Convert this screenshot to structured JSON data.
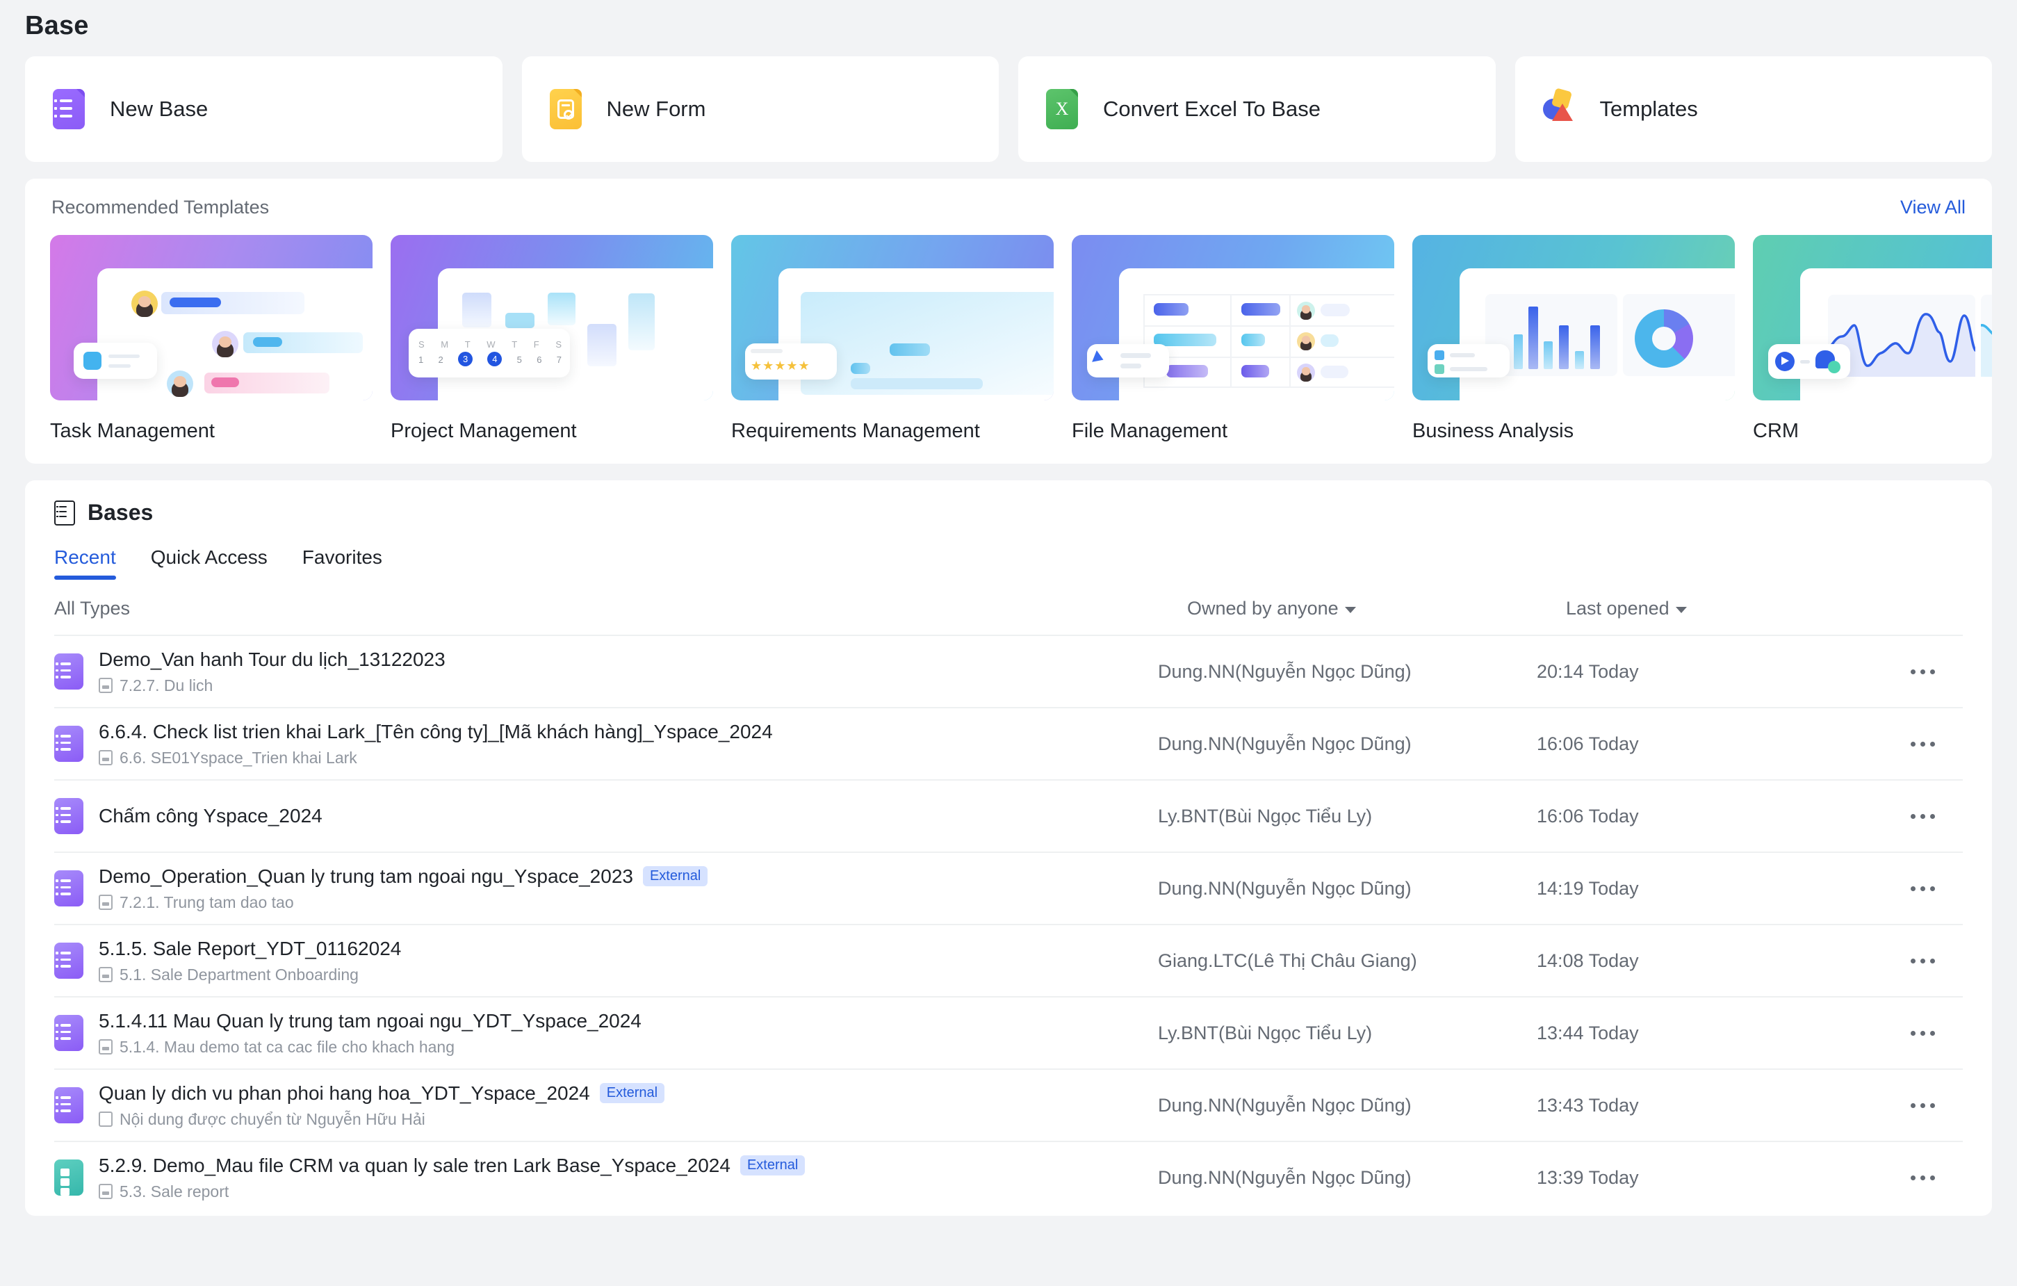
{
  "page": {
    "title": "Base"
  },
  "quick_actions": [
    {
      "label": "New Base",
      "icon": "base-icon"
    },
    {
      "label": "New Form",
      "icon": "form-icon"
    },
    {
      "label": "Convert Excel To Base",
      "icon": "excel-icon"
    },
    {
      "label": "Templates",
      "icon": "templates-icon"
    }
  ],
  "recommended": {
    "title": "Recommended Templates",
    "view_all_label": "View All",
    "templates": [
      {
        "name": "Task Management"
      },
      {
        "name": "Project Management",
        "calendar": {
          "weekdays": [
            "S",
            "M",
            "T",
            "W",
            "T",
            "F",
            "S"
          ],
          "days": [
            "1",
            "2",
            "3",
            "4",
            "5",
            "6",
            "7"
          ],
          "selected": [
            "3",
            "4"
          ]
        }
      },
      {
        "name": "Requirements Management",
        "stars": 5
      },
      {
        "name": "File Management"
      },
      {
        "name": "Business Analysis"
      },
      {
        "name": "CRM"
      }
    ]
  },
  "bases": {
    "title": "Bases",
    "tabs": [
      {
        "label": "Recent",
        "active": true
      },
      {
        "label": "Quick Access",
        "active": false
      },
      {
        "label": "Favorites",
        "active": false
      }
    ],
    "filters": {
      "types": "All Types",
      "owner": "Owned by anyone",
      "last_opened": "Last opened"
    },
    "rows": [
      {
        "title": "Demo_Van hanh Tour du lịch_13122023",
        "badge": "",
        "sub": "7.2.7. Du lich",
        "sub_icon": "base-small-icon",
        "icon_color": "purple",
        "owner": "Dung.NN(Nguyễn Ngọc Dũng)",
        "time": "20:14 Today"
      },
      {
        "title": "6.6.4. Check list trien khai Lark_[Tên công ty]_[Mã khách hàng]_Yspace_2024",
        "badge": "",
        "sub": "6.6. SE01Yspace_Trien khai Lark",
        "sub_icon": "base-small-icon",
        "icon_color": "purple",
        "owner": "Dung.NN(Nguyễn Ngọc Dũng)",
        "time": "16:06 Today"
      },
      {
        "title": "Chấm công Yspace_2024",
        "badge": "",
        "sub": "",
        "sub_icon": "",
        "icon_color": "purple",
        "owner": "Ly.BNT(Bùi Ngọc Tiểu Ly)",
        "time": "16:06 Today"
      },
      {
        "title": "Demo_Operation_Quan ly trung tam ngoai ngu_Yspace_2023",
        "badge": "External",
        "sub": "7.2.1. Trung tam dao tao",
        "sub_icon": "base-small-icon",
        "icon_color": "purple",
        "owner": "Dung.NN(Nguyễn Ngọc Dũng)",
        "time": "14:19 Today"
      },
      {
        "title": "5.1.5. Sale Report_YDT_01162024",
        "badge": "",
        "sub": "5.1. Sale Department Onboarding",
        "sub_icon": "base-small-icon",
        "icon_color": "purple",
        "owner": "Giang.LTC(Lê Thị Châu Giang)",
        "time": "14:08 Today"
      },
      {
        "title": "5.1.4.11 Mau Quan ly trung tam ngoai ngu_YDT_Yspace_2024",
        "badge": "",
        "sub": "5.1.4. Mau demo tat ca cac file cho khach hang",
        "sub_icon": "base-small-icon",
        "icon_color": "purple",
        "owner": "Ly.BNT(Bùi Ngọc Tiểu Ly)",
        "time": "13:44 Today"
      },
      {
        "title": "Quan ly dich vu phan phoi hang hoa_YDT_Yspace_2024",
        "badge": "External",
        "sub": "Nội dung được chuyển từ Nguyễn Hữu Hải",
        "sub_icon": "folder-small-icon",
        "icon_color": "purple",
        "owner": "Dung.NN(Nguyễn Ngọc Dũng)",
        "time": "13:43 Today"
      },
      {
        "title": "5.2.9. Demo_Mau file CRM va quan ly sale tren Lark Base_Yspace_2024",
        "badge": "External",
        "sub": "5.3. Sale report",
        "sub_icon": "base-small-icon",
        "icon_color": "teal",
        "owner": "Dung.NN(Nguyễn Ngọc Dũng)",
        "time": "13:39 Today"
      }
    ],
    "more_label": "•••"
  },
  "colors": {
    "accent": "#245bdb",
    "page_bg": "#f2f3f5",
    "card_bg": "#ffffff",
    "text_primary": "#1f2329",
    "text_secondary": "#646a73",
    "badge_bg": "#d6e2ff"
  }
}
